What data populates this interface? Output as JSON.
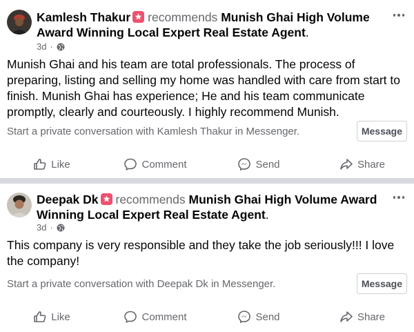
{
  "posts": [
    {
      "author": "Kamlesh Thakur",
      "verb": "recommends",
      "page": "Munish Ghai High Volume Award Winning Local Expert Real Estate Agent",
      "period": ".",
      "time": "3d",
      "body": "Munish Ghai and his team are total professionals. The process of preparing, listing and selling my home was handled with care from start to finish. Munish Ghai has experience; He and his team communicate promptly, clearly and courteously. I highly recommend Munish.",
      "conversation": "Start a private conversation with Kamlesh Thakur in Messenger.",
      "message_button": "Message"
    },
    {
      "author": "Deepak Dk",
      "verb": "recommends",
      "page": "Munish Ghai High Volume Award Winning Local Expert Real Estate Agent",
      "period": ".",
      "time": "3d",
      "body": "This company is very responsible and they take the job seriously!!! I love the company!",
      "conversation": "Start a private conversation with Deepak Dk in Messenger.",
      "message_button": "Message"
    }
  ],
  "actions": {
    "like": "Like",
    "comment": "Comment",
    "send": "Send",
    "share": "Share"
  },
  "icons": {
    "badge": "recommendation-badge-icon",
    "privacy": "globe-icon",
    "more": "more-options-icon"
  },
  "colors": {
    "badge": "#f0506e",
    "secondary_text": "#65676b",
    "separator": "#d7d9de"
  }
}
